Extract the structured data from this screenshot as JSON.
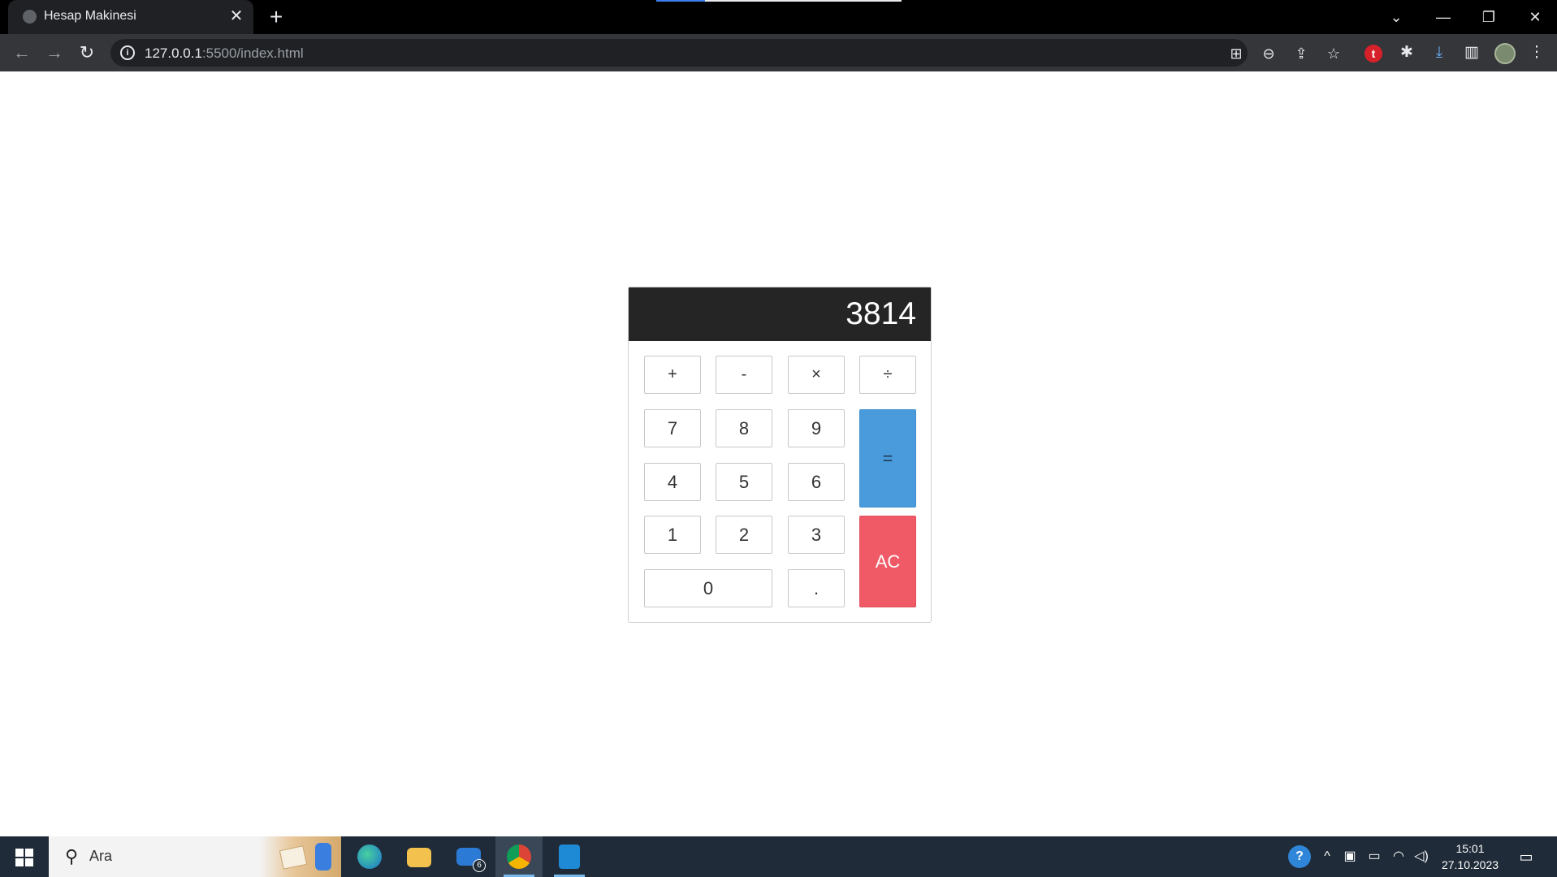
{
  "browser": {
    "tab_title": "Hesap Makinesi",
    "url_host": "127.0.0.1",
    "url_rest": ":5500/index.html"
  },
  "calculator": {
    "display": "3814",
    "operators": [
      "+",
      "-",
      "×",
      "÷"
    ],
    "row1": [
      "7",
      "8",
      "9"
    ],
    "row2": [
      "4",
      "5",
      "6"
    ],
    "row3": [
      "1",
      "2",
      "3"
    ],
    "zero": "0",
    "dot": ".",
    "equal": "=",
    "clear": "AC",
    "colors": {
      "display_bg": "#252525",
      "equal_bg": "#4a9bdc",
      "clear_bg": "#f05a67"
    }
  },
  "taskbar": {
    "search_placeholder": "Ara",
    "mail_badge": "6",
    "time": "15:01",
    "date": "27.10.2023"
  }
}
